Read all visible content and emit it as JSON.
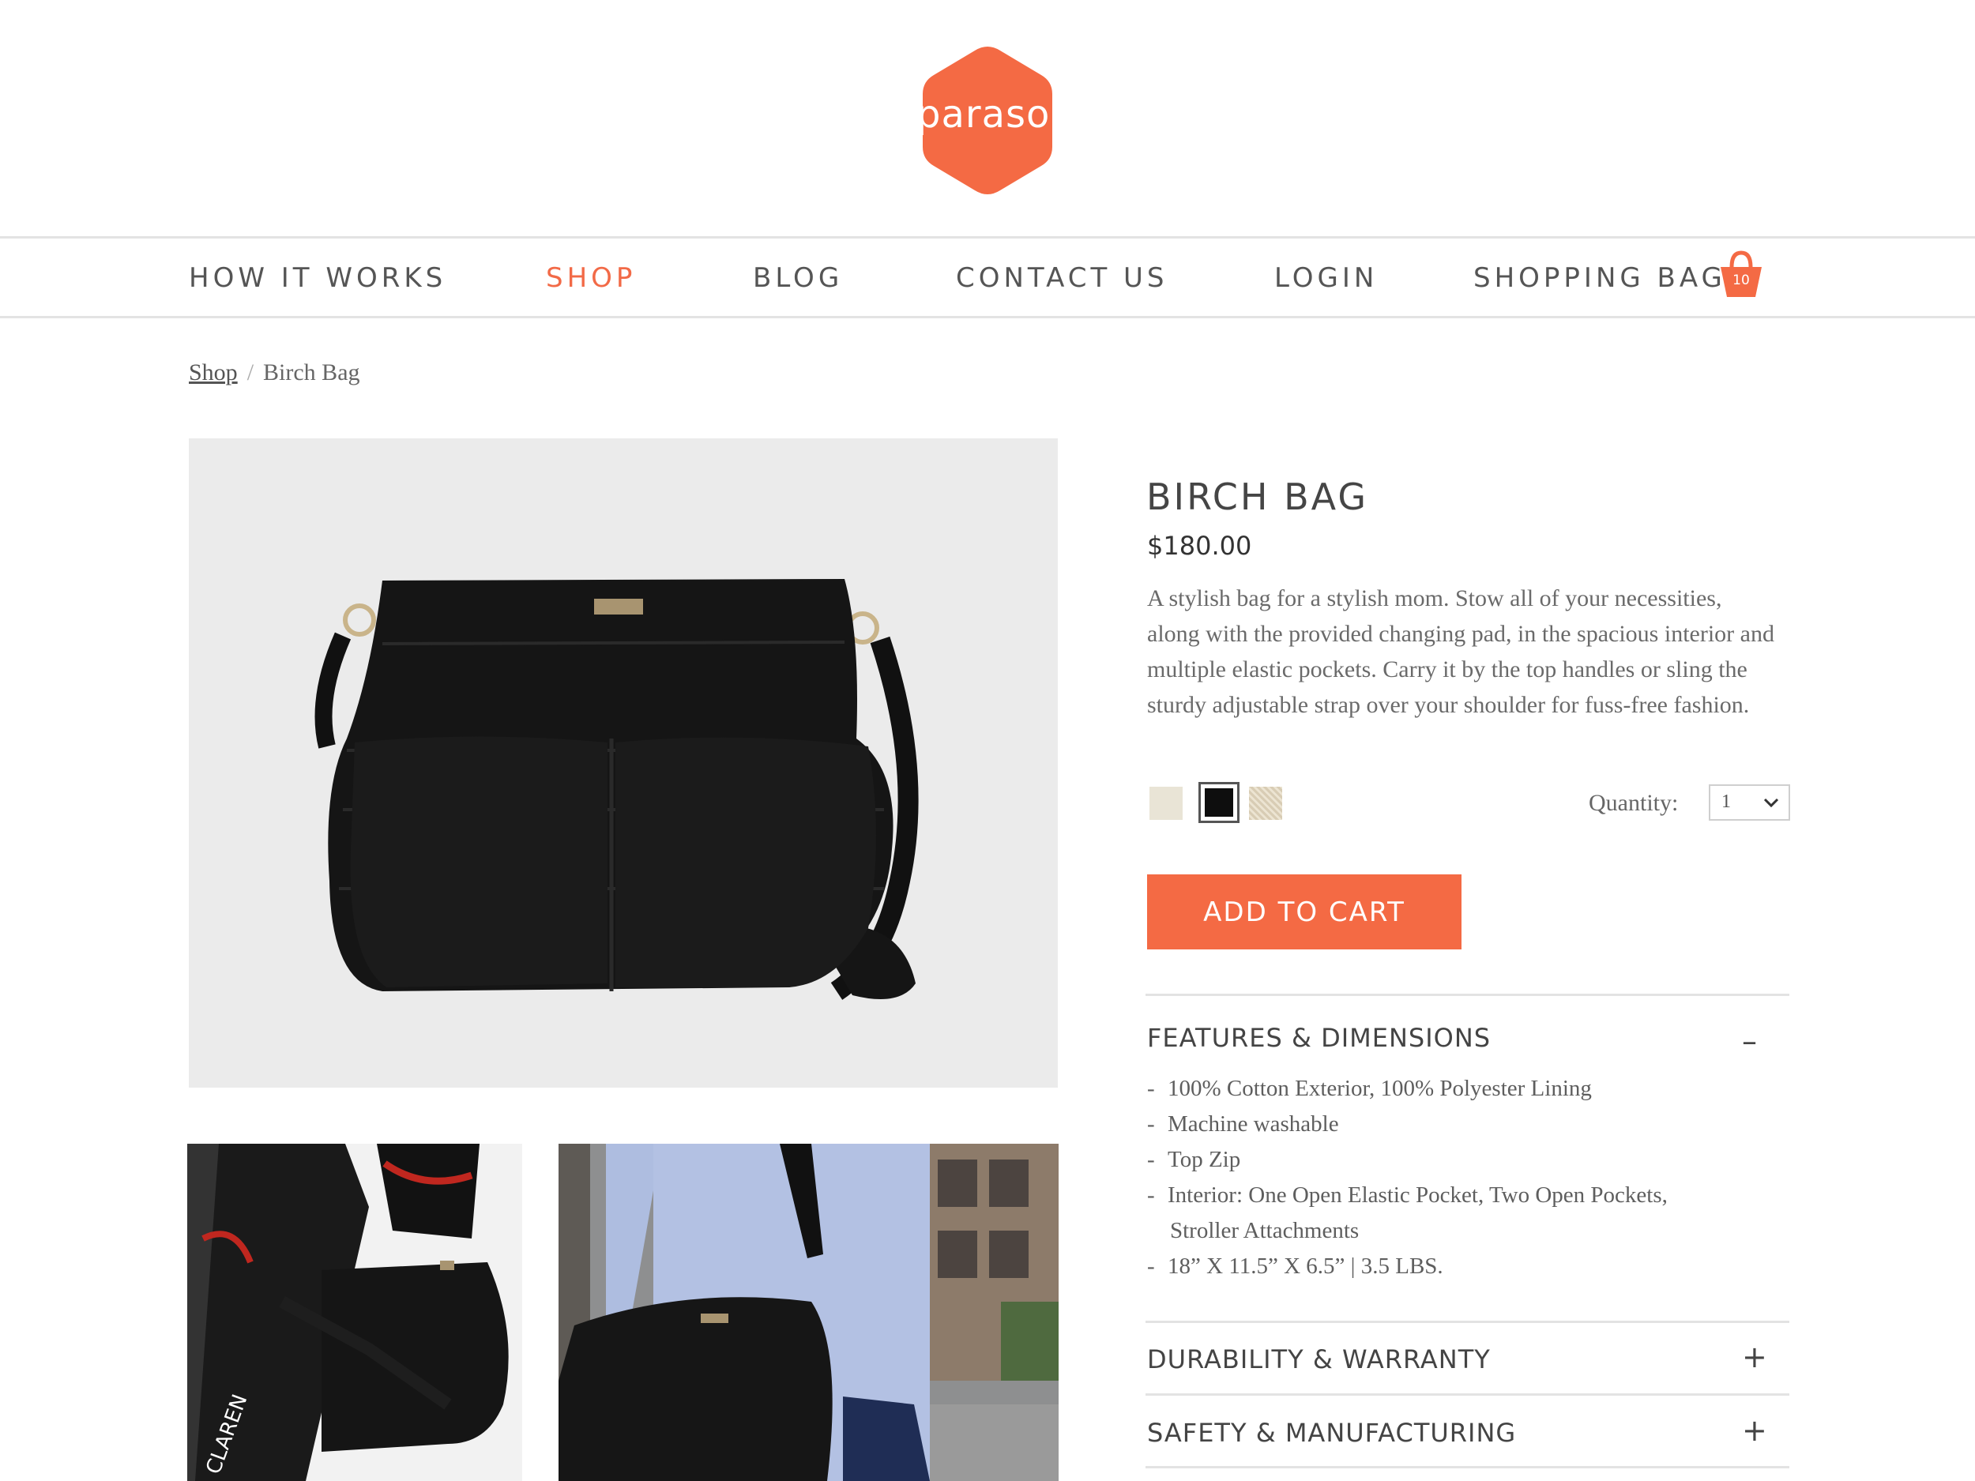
{
  "brand": {
    "name": "parasol",
    "color": "#f26a47"
  },
  "nav": {
    "items": [
      {
        "label": "HOW IT WORKS"
      },
      {
        "label": "SHOP",
        "active": true
      },
      {
        "label": "BLOG"
      },
      {
        "label": "CONTACT US"
      },
      {
        "label": "LOGIN"
      },
      {
        "label": "SHOPPING BAG"
      }
    ],
    "bag_icon": "shopping-basket-icon",
    "bag_count": "10"
  },
  "breadcrumb": {
    "link": "Shop",
    "separator": "/",
    "current": "Birch Bag"
  },
  "product": {
    "title": "BIRCH BAG",
    "price": "$180.00",
    "description": "A stylish bag for a stylish mom. Stow all of your necessities, along with the provided changing pad, in the spacious interior and multiple elastic pockets. Carry it by the top handles or sling the sturdy adjustable strap over your shoulder for fuss-free fashion.",
    "swatches": [
      {
        "color": "#e9e4d6",
        "selected": false
      },
      {
        "color": "#0e0e0e",
        "selected": true
      },
      {
        "color": "#d8ccb4",
        "selected": false
      }
    ],
    "quantity_label": "Quantity:",
    "quantity_value": "1",
    "add_to_cart": "ADD TO CART"
  },
  "accordions": [
    {
      "title": "FEATURES & DIMENSIONS",
      "toggle": "–",
      "expanded": true,
      "items": [
        "100% Cotton Exterior, 100% Polyester Lining",
        "Machine washable",
        "Top Zip",
        "Interior: One Open Elastic Pocket, Two Open Pockets,",
        "18” X 11.5” X 6.5”   |   3.5 LBS."
      ],
      "continuation": "Stroller Attachments"
    },
    {
      "title": "DURABILITY & WARRANTY",
      "toggle": "+",
      "expanded": false
    },
    {
      "title": "SAFETY & MANUFACTURING",
      "toggle": "+",
      "expanded": false
    }
  ],
  "accent_color": "#f46a44",
  "thumbnail_text": "CLAREN"
}
